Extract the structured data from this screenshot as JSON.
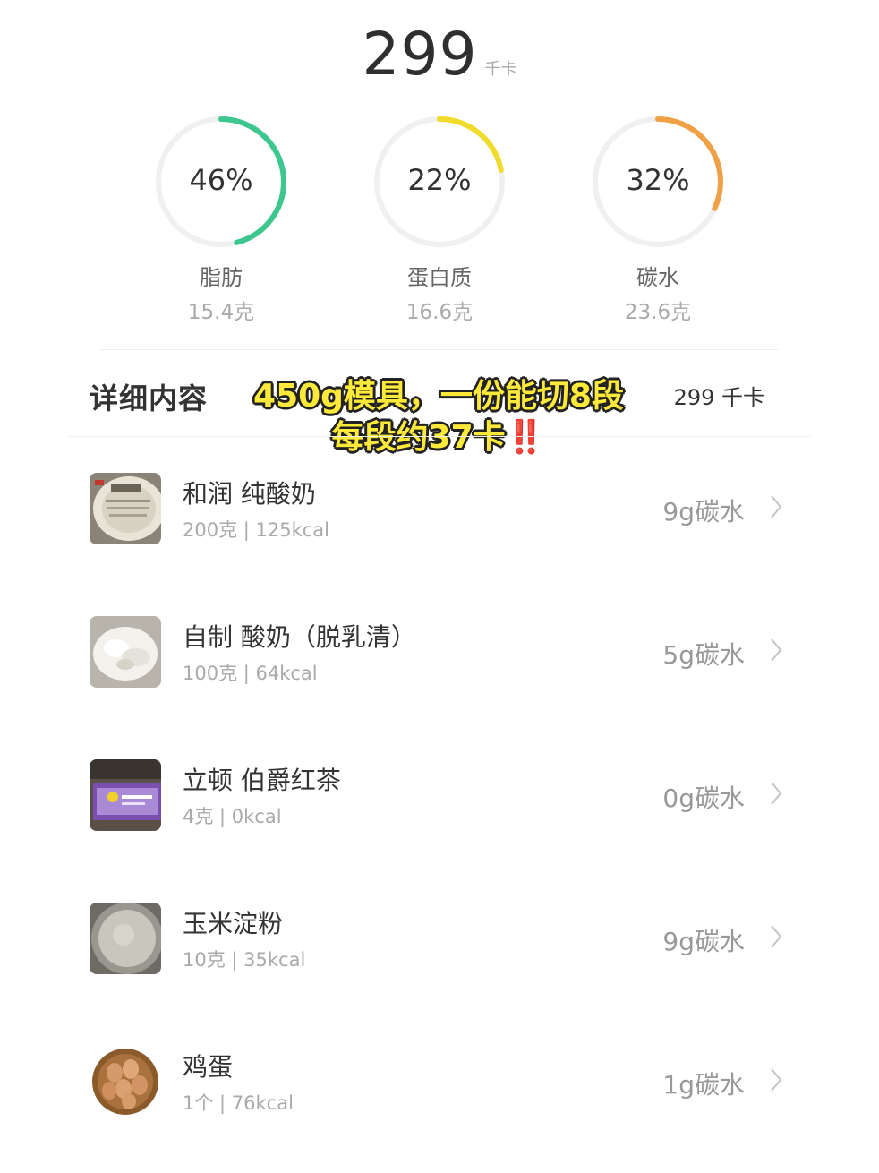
{
  "summary": {
    "total_value": "299",
    "total_unit": "千卡"
  },
  "macros": [
    {
      "name": "脂肪",
      "percent_label": "46%",
      "grams": "15.4克",
      "fraction": 0.46,
      "color": "#3dc68e"
    },
    {
      "name": "蛋白质",
      "percent_label": "22%",
      "grams": "16.6克",
      "fraction": 0.22,
      "color": "#f2dc2b"
    },
    {
      "name": "碳水",
      "percent_label": "32%",
      "grams": "23.6克",
      "fraction": 0.32,
      "color": "#f0a046"
    }
  ],
  "details": {
    "title": "详细内容",
    "total": "299 千卡"
  },
  "overlay": {
    "line1": "450g模具，一份能切8段",
    "line2": "每段约37卡",
    "emphasis": "‼️"
  },
  "items": [
    {
      "name": "和润 纯酸奶",
      "sub": "200克 | 125kcal",
      "carb": "9g碳水",
      "thumb": "yogurt-cup-image"
    },
    {
      "name": "自制 酸奶（脱乳清）",
      "sub": "100克 | 64kcal",
      "carb": "5g碳水",
      "thumb": "greek-yogurt-image"
    },
    {
      "name": "立顿 伯爵红茶",
      "sub": "4克 | 0kcal",
      "carb": "0g碳水",
      "thumb": "tea-box-image"
    },
    {
      "name": "玉米淀粉",
      "sub": "10克 | 35kcal",
      "carb": "9g碳水",
      "thumb": "corn-starch-image"
    },
    {
      "name": "鸡蛋",
      "sub": "1个 | 76kcal",
      "carb": "1g碳水",
      "thumb": "eggs-basket-image"
    }
  ]
}
